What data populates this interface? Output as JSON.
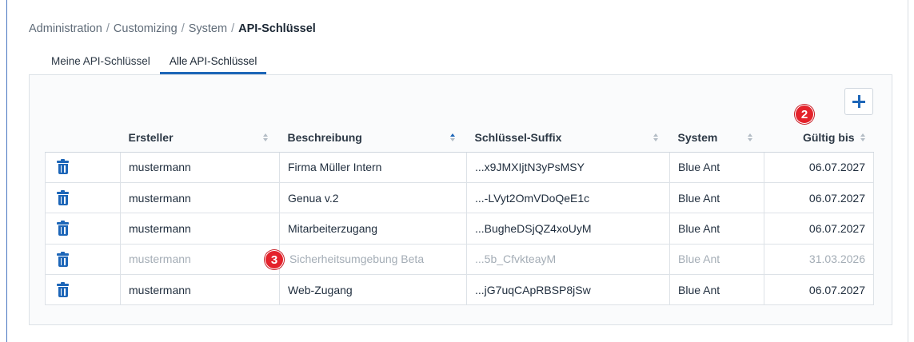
{
  "breadcrumb": {
    "items": [
      "Administration",
      "Customizing",
      "System"
    ],
    "current": "API-Schlüssel",
    "separator": "/"
  },
  "tabs": [
    {
      "label": "Meine API-Schlüssel",
      "active": false
    },
    {
      "label": "Alle API-Schlüssel",
      "active": true
    }
  ],
  "toolbar": {
    "add_icon": "plus-icon"
  },
  "badges": {
    "b2": "2",
    "b3": "3"
  },
  "table": {
    "headers": {
      "creator": "Ersteller",
      "description": "Beschreibung",
      "suffix": "Schlüssel-Suffix",
      "system": "System",
      "valid_until": "Gültig bis"
    },
    "sorted_column": "description",
    "rows": [
      {
        "creator": "mustermann",
        "description": "Firma Müller Intern",
        "suffix": "...x9JMXIjtN3yPsMSY",
        "system": "Blue Ant",
        "valid_until": "06.07.2027",
        "inactive": false
      },
      {
        "creator": "mustermann",
        "description": "Genua v.2",
        "suffix": "...-LVyt2OmVDoQeE1c",
        "system": "Blue Ant",
        "valid_until": "06.07.2027",
        "inactive": false
      },
      {
        "creator": "mustermann",
        "description": "Mitarbeiterzugang",
        "suffix": "...BugheDSjQZ4xoUyM",
        "system": "Blue Ant",
        "valid_until": "06.07.2027",
        "inactive": false
      },
      {
        "creator": "mustermann",
        "description": "Sicherheitsumgebung Beta",
        "suffix": "...5b_CfvkteayM",
        "system": "Blue Ant",
        "valid_until": "31.03.2026",
        "inactive": true
      },
      {
        "creator": "mustermann",
        "description": "Web-Zugang",
        "suffix": "...jG7uqCApRBSP8jSw",
        "system": "Blue Ant",
        "valid_until": "06.07.2027",
        "inactive": false
      }
    ]
  },
  "colors": {
    "accent": "#1d66b8",
    "badge": "#e4222b",
    "inactive_text": "#a4adb6"
  }
}
